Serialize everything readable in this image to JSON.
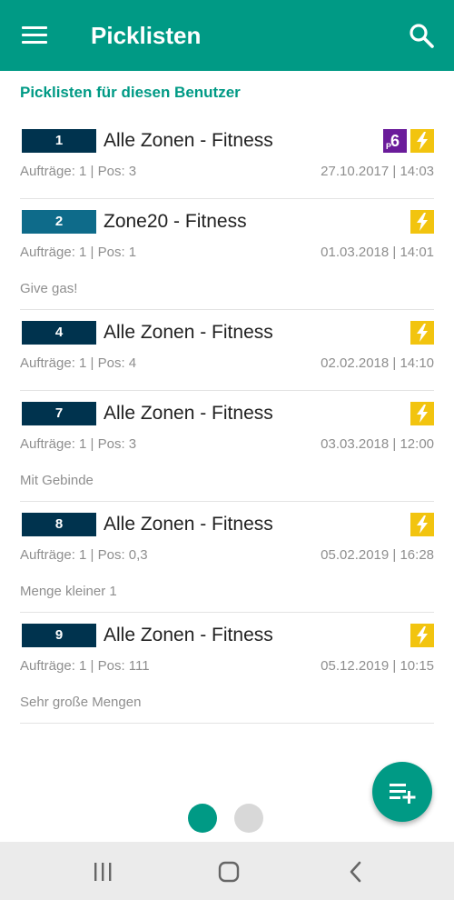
{
  "appbar": {
    "title": "Picklisten",
    "menu_icon": "hamburger-menu-icon",
    "search_icon": "search-icon"
  },
  "section_header": "Picklisten für diesen Benutzer",
  "items": [
    {
      "number": "1",
      "title": "Alle Zonen - Fitness",
      "meta": "Aufträge: 1 | Pos: 3",
      "date": "27.10.2017 | 14:03",
      "note": "",
      "icons": [
        "p6-icon",
        "bolt-icon"
      ],
      "p6_label": "6",
      "p6_sub": "P"
    },
    {
      "number": "2",
      "title": "Zone20 - Fitness",
      "meta": "Aufträge: 1 | Pos: 1",
      "date": "01.03.2018 | 14:01",
      "note": "Give gas!",
      "icons": [
        "bolt-icon"
      ]
    },
    {
      "number": "4",
      "title": "Alle Zonen - Fitness",
      "meta": "Aufträge: 1 | Pos: 4",
      "date": "02.02.2018 | 14:10",
      "note": "",
      "icons": [
        "bolt-icon"
      ]
    },
    {
      "number": "7",
      "title": "Alle Zonen - Fitness",
      "meta": "Aufträge: 1 | Pos: 3",
      "date": "03.03.2018 | 12:00",
      "note": "Mit Gebinde",
      "icons": [
        "bolt-icon"
      ]
    },
    {
      "number": "8",
      "title": "Alle Zonen - Fitness",
      "meta": "Aufträge: 1 | Pos: 0,3",
      "date": "05.02.2019 | 16:28",
      "note": "Menge kleiner 1",
      "icons": [
        "bolt-icon"
      ]
    },
    {
      "number": "9",
      "title": "Alle Zonen - Fitness",
      "meta": "Aufträge: 1 | Pos: 111",
      "date": "05.12.2019 | 10:15",
      "note": "Sehr große Mengen",
      "icons": [
        "bolt-icon"
      ]
    }
  ],
  "pager": {
    "pages": 2,
    "active": 1
  },
  "fab_icon": "playlist-add-icon",
  "colors": {
    "primary": "#009a85",
    "badge": "#00334e",
    "badge_alt": "#0e6b8a",
    "bolt": "#f2c40f",
    "p6": "#6a1b9a"
  }
}
